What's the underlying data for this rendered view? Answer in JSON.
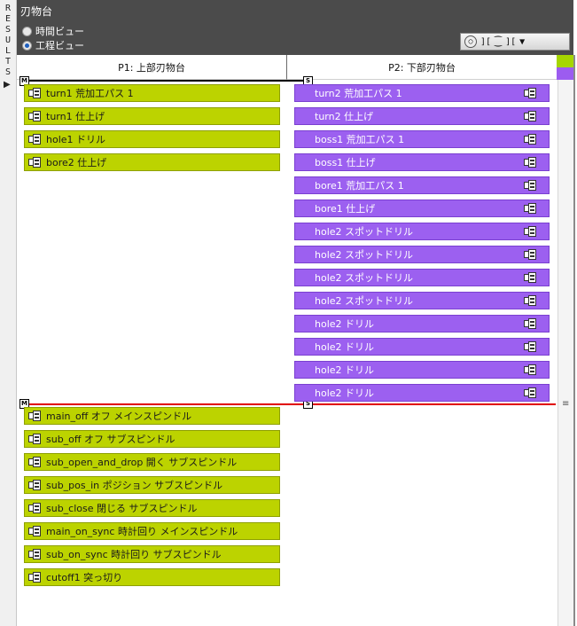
{
  "results_tab": {
    "letters": "R\nE\nS\nU\nL\nT\nS",
    "arrow": "▶"
  },
  "header": {
    "title": "刃物台",
    "radios": [
      {
        "label": "時間ビュー",
        "checked": false
      },
      {
        "label": "工程ビュー",
        "checked": true
      }
    ],
    "toolbar": {
      "btn1": "◯",
      "btn2": "][",
      "btn3": "⁐",
      "btn4": "][",
      "btn5": "▼"
    }
  },
  "columns": {
    "p1": "P1: 上部刃物台",
    "p2": "P2: 下部刃物台"
  },
  "markers": {
    "m": "M",
    "s": "S"
  },
  "colors": {
    "green": "#bcd300",
    "purple": "#9c60f0",
    "sync_line_black": "#000000",
    "sync_line_red": "#e00000",
    "legend_green": "#a6d600",
    "legend_purple": "#9c5cf0"
  },
  "p1_items": [
    "turn1  荒加工パス 1",
    "turn1  仕上げ",
    "hole1  ドリル",
    "bore2  仕上げ"
  ],
  "p2_items": [
    "turn2  荒加工パス 1",
    "turn2  仕上げ",
    "boss1  荒加工パス 1",
    "boss1  仕上げ",
    "bore1  荒加工パス 1",
    "bore1  仕上げ",
    "hole2  スポットドリル",
    "hole2  スポットドリル",
    "hole2  スポットドリル",
    "hole2  スポットドリル",
    "hole2  ドリル",
    "hole2  ドリル",
    "hole2  ドリル",
    "hole2  ドリル"
  ],
  "sync_items": [
    "main_off  オフ メインスピンドル",
    "sub_off  オフ サブスピンドル",
    "sub_open_and_drop  開く サブスピンドル",
    "sub_pos_in  ポジション サブスピンドル",
    "sub_close  閉じる サブスピンドル",
    "main_on_sync  時計回り メインスピンドル",
    "sub_on_sync  時計回り サブスピンドル",
    "cutoff1  突っ切り"
  ],
  "scroll_grip": "≡",
  "icons": {
    "op": "operation-icon"
  }
}
